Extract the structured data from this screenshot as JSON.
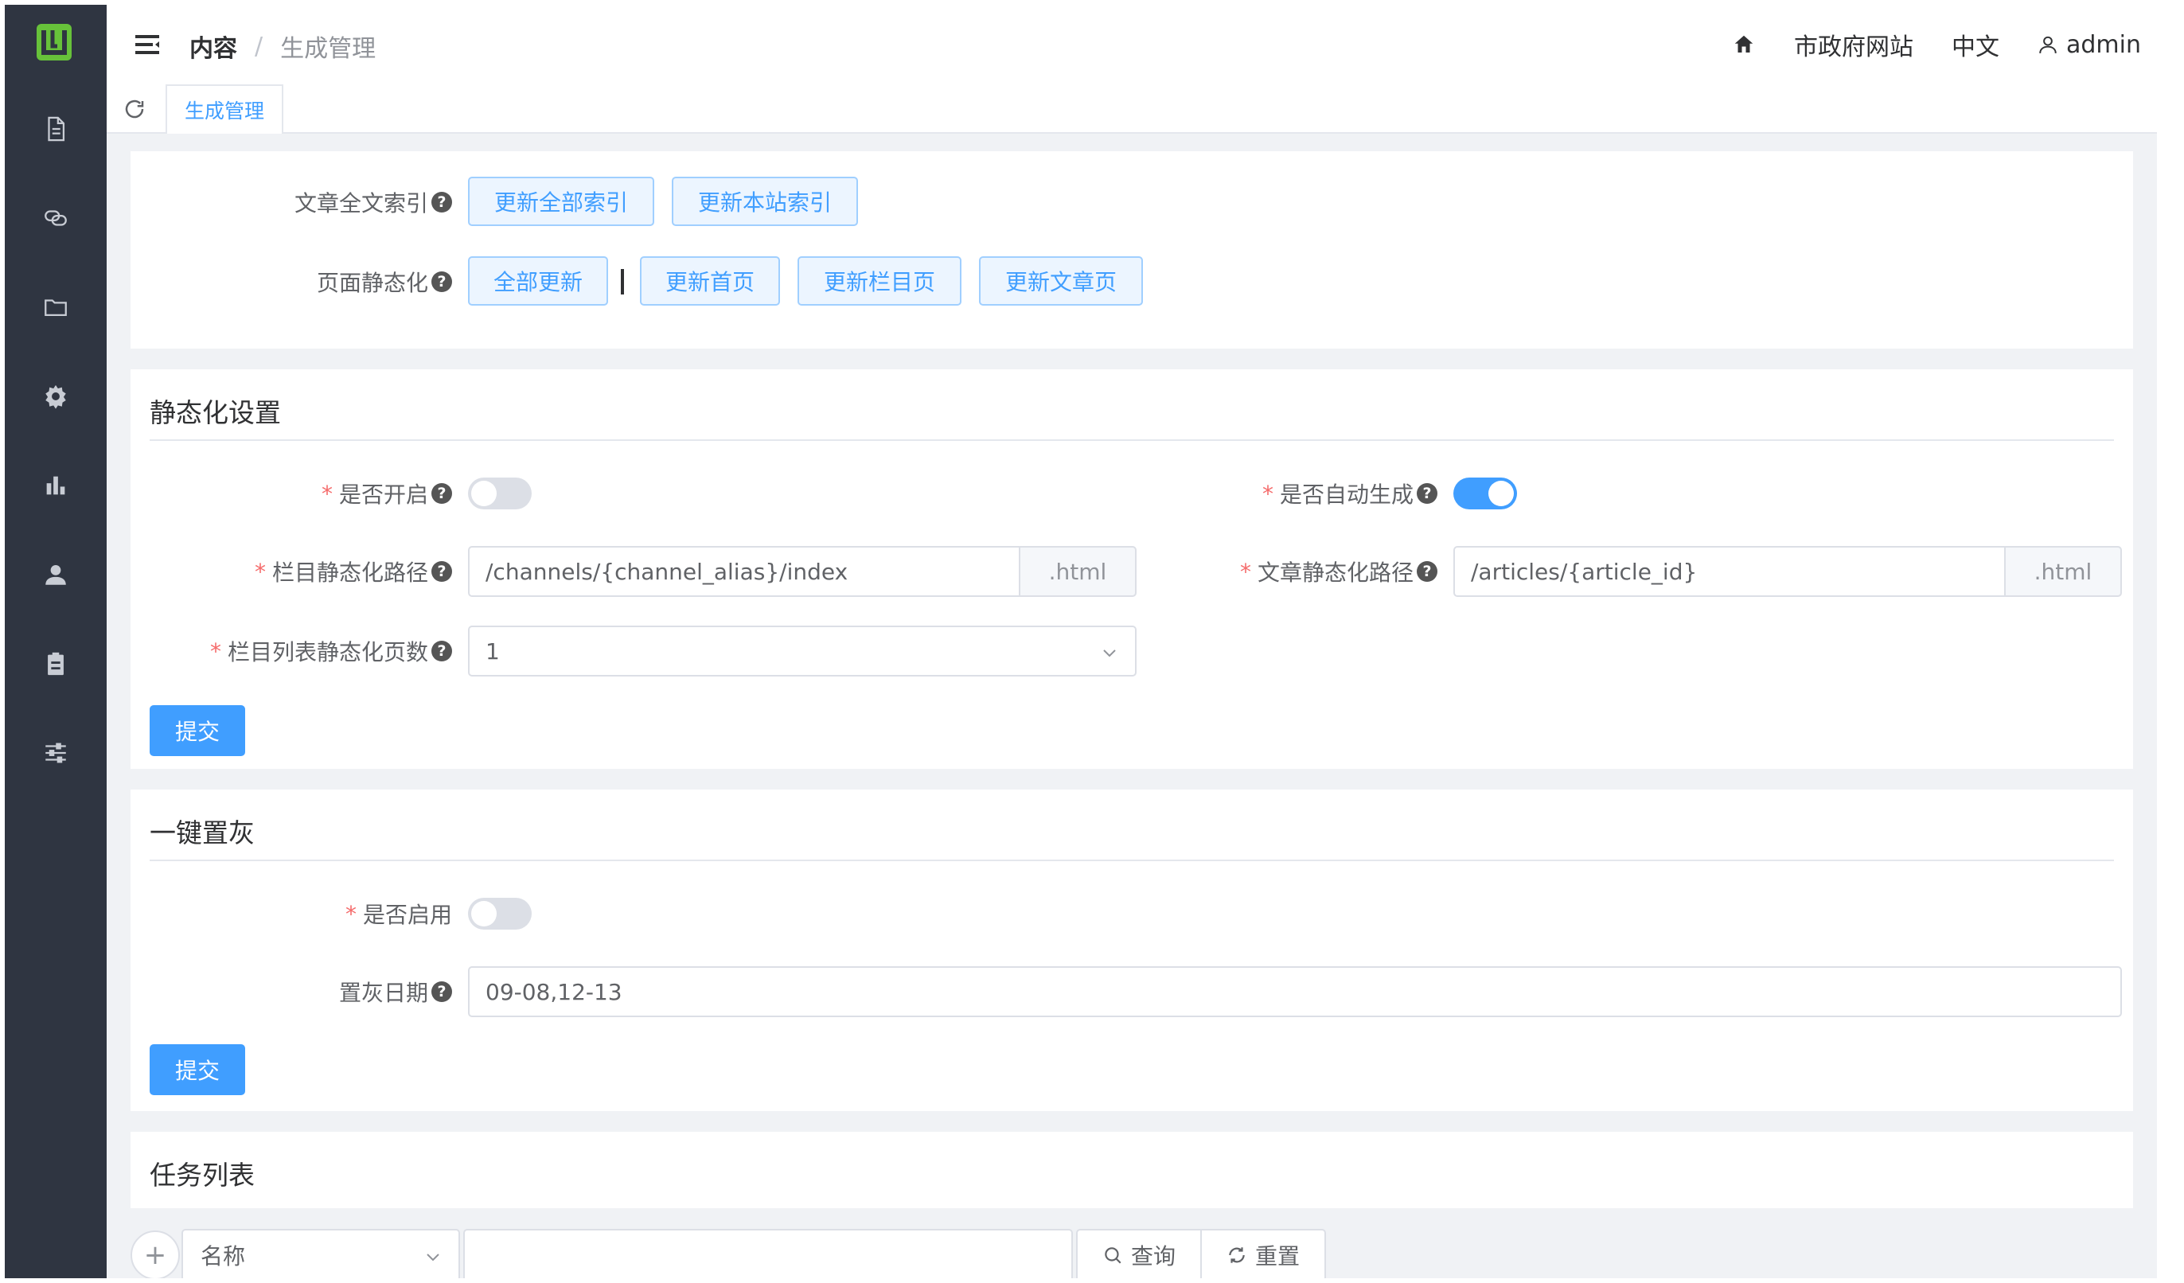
{
  "header": {
    "breadcrumb": [
      "内容",
      "生成管理"
    ],
    "right": {
      "site": "市政府网站",
      "language": "中文",
      "user": "admin"
    }
  },
  "tags": {
    "active": "生成管理"
  },
  "sidebar": {
    "icons": [
      "document-icon",
      "link-icon",
      "folder-icon",
      "gear-icon",
      "bar-chart-icon",
      "user-icon",
      "clipboard-icon",
      "sliders-icon"
    ]
  },
  "index_card": {
    "fulltext_label": "文章全文索引",
    "fulltext_buttons": [
      "更新全部索引",
      "更新本站索引"
    ],
    "static_label": "页面静态化",
    "static_all": "全部更新",
    "static_separator": "|",
    "static_buttons": [
      "更新首页",
      "更新栏目页",
      "更新文章页"
    ]
  },
  "static_settings": {
    "title": "静态化设置",
    "enabled_label": "是否开启",
    "enabled": false,
    "auto_label": "是否自动生成",
    "auto": true,
    "channel_path_label": "栏目静态化路径",
    "channel_path": "/channels/{channel_alias}/index",
    "channel_suffix": ".html",
    "article_path_label": "文章静态化路径",
    "article_path": "/articles/{article_id}",
    "article_suffix": ".html",
    "pages_label": "栏目列表静态化页数",
    "pages_value": "1",
    "submit": "提交"
  },
  "gray": {
    "title": "一键置灰",
    "enable_label": "是否启用",
    "enabled": false,
    "date_label": "置灰日期",
    "date_value": "09-08,12-13",
    "submit": "提交"
  },
  "tasks": {
    "title": "任务列表",
    "add": "+",
    "field_select": "名称",
    "search_value": "",
    "query": "查询",
    "reset": "重置"
  },
  "colors": {
    "primary": "#409eff",
    "sidebar": "#2f3541",
    "logo": "#67c23a",
    "required": "#f56c6c"
  }
}
